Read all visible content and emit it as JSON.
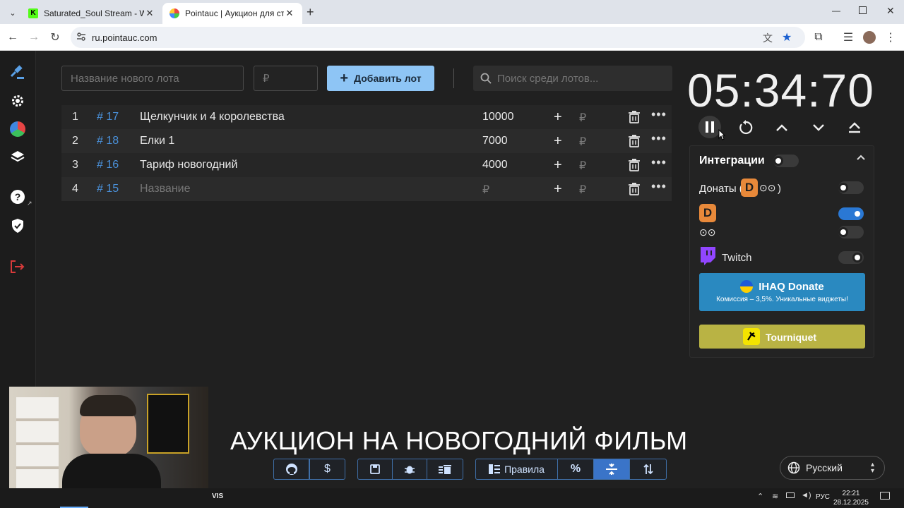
{
  "browser": {
    "tabs": [
      {
        "title": "Saturated_Soul Stream - Watch",
        "active": false
      },
      {
        "title": "Pointauc | Аукцион для стримеров",
        "active": true
      }
    ],
    "url": "ru.pointauc.com"
  },
  "controls": {
    "lot_name_placeholder": "Название нового лота",
    "amount_placeholder": "₽",
    "add_button_label": "Добавить лот",
    "search_placeholder": "Поиск среди лотов..."
  },
  "lots": [
    {
      "index": "1",
      "id": "# 17",
      "name": "Щелкунчик и 4 королевства",
      "amount": "10000"
    },
    {
      "index": "2",
      "id": "# 18",
      "name": "Елки 1",
      "amount": "7000"
    },
    {
      "index": "3",
      "id": "# 16",
      "name": "Тариф новогодний",
      "amount": "4000"
    },
    {
      "index": "4",
      "id": "# 15",
      "name": "Название",
      "amount": "₽"
    }
  ],
  "currency_symbol": "₽",
  "timer": "05:34:70",
  "integrations": {
    "title": "Интеграции",
    "donations_label": "Донаты (",
    "donations_suffix": ")",
    "twitch_label": "Twitch",
    "ihaq_title": "IHAQ Donate",
    "ihaq_subtitle": "Комиссия – 3,5%. Уникальные виджеты!",
    "tourniquet_label": "Tourniquet",
    "toggles": {
      "main": false,
      "donations": false,
      "donationalerts": true,
      "da_alt": false,
      "twitch": false
    }
  },
  "caption": "АУКЦИОН НА НОВОГОДНИЙ ФИЛЬМ",
  "bottom_bar": {
    "rules_label": "Правила",
    "dollar": "$",
    "percent": "%"
  },
  "language": "Русский",
  "taskbar": {
    "lang": "РУС",
    "time": "22:21",
    "date": "28.12.2025"
  },
  "colors": {
    "accent": "#8ec5f5",
    "id_blue": "#4a90d9",
    "toggle_on": "#2a78d4",
    "ihaq": "#2a89c0",
    "tourniquet": "#b9b344"
  }
}
